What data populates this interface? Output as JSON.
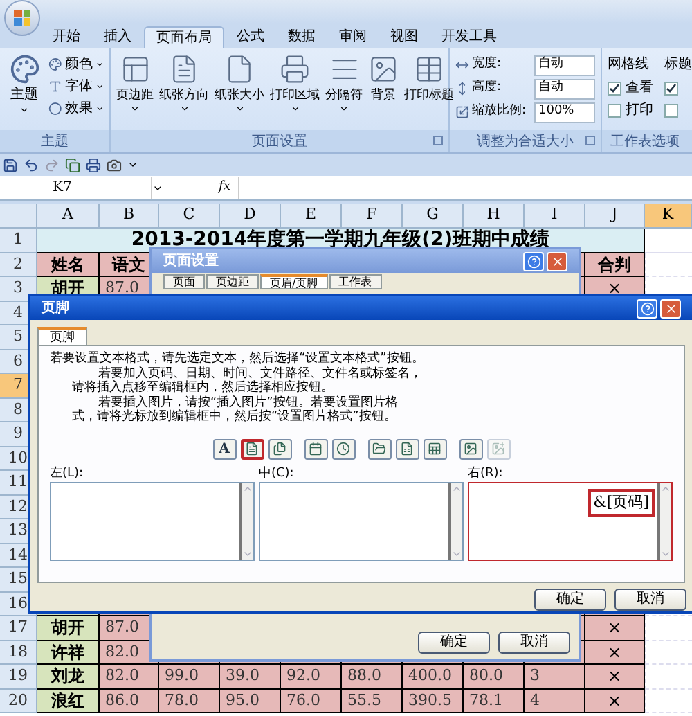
{
  "ribbon": {
    "tabs": [
      {
        "label": "开始",
        "selected": false
      },
      {
        "label": "插入",
        "selected": false
      },
      {
        "label": "页面布局",
        "selected": true
      },
      {
        "label": "公式",
        "selected": false
      },
      {
        "label": "数据",
        "selected": false
      },
      {
        "label": "审阅",
        "selected": false
      },
      {
        "label": "视图",
        "selected": false
      },
      {
        "label": "开发工具",
        "selected": false
      }
    ],
    "theme_group": {
      "title": "主题",
      "main": "主题",
      "items": [
        {
          "kind": "colors",
          "label": "颜色"
        },
        {
          "kind": "fonts",
          "label": "字体"
        },
        {
          "kind": "effects",
          "label": "效果"
        }
      ]
    },
    "page_setup_group": {
      "title": "页面设置",
      "buttons": [
        {
          "kind": "margins",
          "label": "页边距",
          "dropdown": true
        },
        {
          "kind": "orientation",
          "label": "纸张方向",
          "dropdown": true
        },
        {
          "kind": "size",
          "label": "纸张大小",
          "dropdown": true
        },
        {
          "kind": "print-area",
          "label": "打印区域",
          "dropdown": true
        },
        {
          "kind": "breaks",
          "label": "分隔符",
          "dropdown": true
        },
        {
          "kind": "background",
          "label": "背景",
          "dropdown": false
        },
        {
          "kind": "print-titles",
          "label": "打印标题",
          "dropdown": false
        }
      ]
    },
    "fit_group": {
      "title": "调整为合适大小",
      "rows": [
        {
          "kind": "width",
          "label": "宽度:",
          "value": "自动"
        },
        {
          "kind": "height",
          "label": "高度:",
          "value": "自动"
        },
        {
          "kind": "scale",
          "label": "缩放比例:",
          "value": "100%"
        }
      ]
    },
    "sheet_options_group": {
      "title": "工作表选项",
      "columns": [
        {
          "title": "网格线",
          "options": [
            {
              "label": "查看",
              "checked": true
            },
            {
              "label": "打印",
              "checked": false
            }
          ]
        },
        {
          "title": "标题",
          "options": [
            {
              "checked": true
            },
            {
              "checked": false
            }
          ]
        }
      ]
    }
  },
  "formula_bar": {
    "name_box": "K7",
    "function_label": "fx"
  },
  "sheet": {
    "columns": [
      {
        "label": "A",
        "selected": false
      },
      {
        "label": "B",
        "selected": false
      },
      {
        "label": "C",
        "selected": false
      },
      {
        "label": "D",
        "selected": false
      },
      {
        "label": "E",
        "selected": false
      },
      {
        "label": "F",
        "selected": false
      },
      {
        "label": "G",
        "selected": false
      },
      {
        "label": "H",
        "selected": false
      },
      {
        "label": "I",
        "selected": false
      },
      {
        "label": "J",
        "selected": false
      },
      {
        "label": "K",
        "selected": true
      }
    ],
    "rows": [
      {
        "number": "1",
        "selected": false,
        "kind": "title",
        "title": "2013-2014年度第一学期九年级(2)班期中成绩"
      },
      {
        "number": "2",
        "selected": false,
        "kind": "header",
        "cells": [
          "姓名",
          "语文",
          null,
          null,
          null,
          null,
          null,
          null,
          null,
          "合判"
        ]
      },
      {
        "number": "3",
        "selected": false,
        "kind": "data",
        "cells": [
          "胡开",
          "87.0",
          null,
          null,
          null,
          null,
          null,
          null,
          null,
          "×"
        ]
      },
      {
        "number": "4",
        "selected": false,
        "kind": "data"
      },
      {
        "number": "5",
        "selected": false,
        "kind": "data"
      },
      {
        "number": "6",
        "selected": false,
        "kind": "data"
      },
      {
        "number": "7",
        "selected": true,
        "kind": "data"
      },
      {
        "number": "8",
        "selected": false,
        "kind": "data"
      },
      {
        "number": "9",
        "selected": false,
        "kind": "data"
      },
      {
        "number": "10",
        "selected": false,
        "kind": "data"
      },
      {
        "number": "11",
        "selected": false,
        "kind": "data"
      },
      {
        "number": "12",
        "selected": false,
        "kind": "data"
      },
      {
        "number": "13",
        "selected": false,
        "kind": "data"
      },
      {
        "number": "14",
        "selected": false,
        "kind": "data"
      },
      {
        "number": "15",
        "selected": false,
        "kind": "data"
      },
      {
        "number": "16",
        "selected": false,
        "kind": "data"
      },
      {
        "number": "17",
        "selected": false,
        "kind": "data",
        "cells": [
          "胡开",
          "87.0",
          null,
          null,
          null,
          null,
          null,
          null,
          null,
          "×"
        ]
      },
      {
        "number": "18",
        "selected": false,
        "kind": "data",
        "cells": [
          "许祥",
          "82.0",
          null,
          null,
          null,
          null,
          null,
          null,
          null,
          "×"
        ]
      },
      {
        "number": "19",
        "selected": false,
        "kind": "data",
        "cells": [
          "刘龙",
          "82.0",
          "99.0",
          "39.0",
          "92.0",
          "88.0",
          "400.0",
          "80.0",
          "3",
          "×"
        ]
      },
      {
        "number": "20",
        "selected": false,
        "kind": "data",
        "cells": [
          "浪红",
          "86.0",
          "78.0",
          "95.0",
          "76.0",
          "55.5",
          "390.5",
          "78.1",
          "4",
          "×"
        ]
      }
    ]
  },
  "page_setup_dialog": {
    "title": "页面设置",
    "tabs": [
      {
        "label": "页面",
        "selected": false
      },
      {
        "label": "页边距",
        "selected": false
      },
      {
        "label": "页眉/页脚",
        "selected": true
      },
      {
        "label": "工作表",
        "selected": false
      }
    ],
    "buttons": [
      "确定",
      "取消"
    ]
  },
  "footer_dialog": {
    "title": "页脚",
    "tabs": [
      {
        "label": "页脚",
        "selected": true
      }
    ],
    "instructions": [
      {
        "kind": "first",
        "text": "若要设置文本格式，请先选定文本，然后选择“设置文本格式”按钮。"
      },
      {
        "kind": "indented",
        "text": "若要加入页码、日期、时间、文件路径、文件名或标签名，"
      },
      {
        "kind": "continued",
        "text": "请将插入点移至编辑框内，然后选择相应按钮。"
      },
      {
        "kind": "indented",
        "text": "若要插入图片，请按“插入图片”按钮。若要设置图片格"
      },
      {
        "kind": "continued",
        "text": "式，请将光标放到编辑框中，然后按“设置图片格式”按钮。"
      }
    ],
    "toolbar": [
      {
        "kind": "format-text",
        "label": "A",
        "highlighted": false,
        "disabled": false
      },
      {
        "kind": "page-number",
        "highlighted": true,
        "disabled": false
      },
      {
        "kind": "page-count",
        "highlighted": false,
        "disabled": false
      },
      {
        "kind": "date",
        "highlighted": false,
        "disabled": false
      },
      {
        "kind": "time",
        "highlighted": false,
        "disabled": false
      },
      {
        "kind": "file-path",
        "highlighted": false,
        "disabled": false
      },
      {
        "kind": "file-name",
        "highlighted": false,
        "disabled": false
      },
      {
        "kind": "sheet-name",
        "highlighted": false,
        "disabled": false
      },
      {
        "kind": "picture",
        "highlighted": false,
        "disabled": false
      },
      {
        "kind": "format-picture",
        "highlighted": false,
        "disabled": true
      }
    ],
    "sections": [
      {
        "label": "左(L):",
        "highlighted": false
      },
      {
        "label": "中(C):",
        "highlighted": false
      },
      {
        "label": "右(R):",
        "value": "&[页码]",
        "highlighted": true
      }
    ],
    "buttons": [
      "确定",
      "取消"
    ]
  }
}
